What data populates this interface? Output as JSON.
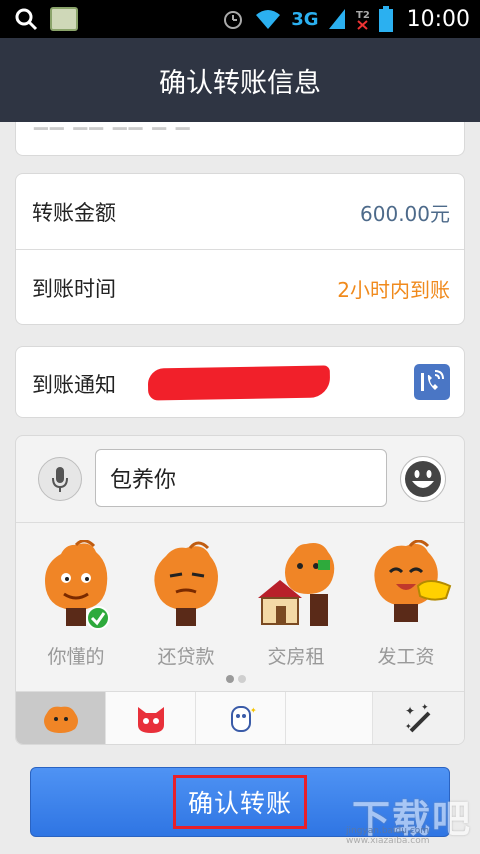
{
  "status_bar": {
    "network": "3G",
    "time": "10:00",
    "icons": [
      "search-icon",
      "notification-thumbnail-icon",
      "alarm-icon",
      "wifi-icon",
      "signal-icon",
      "no-sim-icon",
      "battery-icon"
    ]
  },
  "header": {
    "title": "确认转账信息"
  },
  "transfer": {
    "amount_label": "转账金额",
    "amount_value": "600.00元",
    "arrival_label": "到账时间",
    "arrival_value": "2小时内到账"
  },
  "notify": {
    "label": "到账通知"
  },
  "message": {
    "value": "包养你"
  },
  "stickers": [
    {
      "label": "你懂的",
      "selected": true
    },
    {
      "label": "还贷款",
      "selected": false
    },
    {
      "label": "交房租",
      "selected": false
    },
    {
      "label": "发工资",
      "selected": false
    }
  ],
  "sticker_page": {
    "current": 1,
    "total": 2
  },
  "sticker_tabs": [
    "orange-mascot-icon",
    "red-cat-icon",
    "white-character-icon",
    "empty",
    "magic-wand-icon"
  ],
  "confirm": {
    "label": "确认转账"
  },
  "watermark": {
    "text": "下载吧",
    "sub": "jingyan.baidu.com  www.xiazaiba.com"
  },
  "colors": {
    "accent": "#2f75e3",
    "amount": "#4d6a8a",
    "arrival": "#f08a1c",
    "title_bar": "#2f3543"
  }
}
